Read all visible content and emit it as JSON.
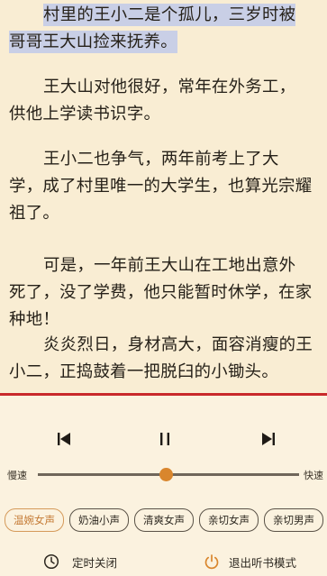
{
  "reader": {
    "paragraphs": [
      {
        "lines": [
          {
            "text": "村里的王小二是个孤儿，三岁时被",
            "indent": true,
            "highlight": true
          },
          {
            "text": "哥哥王大山捡来抚养。",
            "indent": false,
            "highlight": true
          }
        ]
      },
      {
        "lines": [
          {
            "text": "王大山对他很好，常年在外务工，",
            "indent": true,
            "highlight": false
          },
          {
            "text": "供他上学读书识字。",
            "indent": false,
            "highlight": false
          }
        ]
      },
      {
        "lines": [
          {
            "text": "王小二也争气，两年前考上了大",
            "indent": true,
            "highlight": false
          },
          {
            "text": "学，成了村里唯一的大学生，也算光宗耀",
            "indent": false,
            "highlight": false
          },
          {
            "text": "祖了。",
            "indent": false,
            "highlight": false
          }
        ]
      },
      {
        "lines": [
          {
            "text": "可是，一年前王大山在工地出意外",
            "indent": true,
            "highlight": false
          },
          {
            "text": "死了，没了学费，他只能暂时休学，在家",
            "indent": false,
            "highlight": false
          },
          {
            "text": "种地！",
            "indent": false,
            "highlight": false
          }
        ]
      },
      {
        "lines": [
          {
            "text": "炎炎烈日，身材高大，面容消瘦的王",
            "indent": true,
            "highlight": false
          },
          {
            "text": "小二，正捣鼓着一把脱臼的小锄头。",
            "indent": false,
            "highlight": false
          }
        ]
      }
    ]
  },
  "player": {
    "slow_label": "慢速",
    "fast_label": "快速",
    "speed_fraction": 0.49,
    "voices": [
      {
        "label": "温婉女声",
        "active": true
      },
      {
        "label": "奶油小声",
        "active": false
      },
      {
        "label": "清爽女声",
        "active": false
      },
      {
        "label": "亲切女声",
        "active": false
      },
      {
        "label": "亲切男声",
        "active": false
      }
    ],
    "timer_label": "定时关闭",
    "exit_label": "退出听书模式"
  },
  "colors": {
    "accent": "#d9862d",
    "highlight": "#c9cfe6",
    "progress": "#c9292b"
  }
}
